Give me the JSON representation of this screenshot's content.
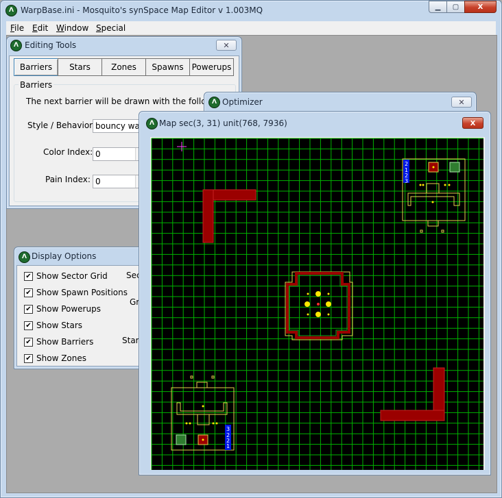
{
  "main_window": {
    "title": "WarpBase.ini - Mosquito's synSpace Map Editor v 1.003MQ",
    "icon": "mosquito-app-icon",
    "minimize_glyph": "▁",
    "maximize_glyph": "▢",
    "close_glyph": "X"
  },
  "menu": {
    "file": {
      "hotkey": "F",
      "rest": "ile"
    },
    "edit": {
      "hotkey": "E",
      "rest": "dit"
    },
    "window": {
      "hotkey": "W",
      "rest": "indow"
    },
    "special": {
      "hotkey": "S",
      "rest": "pecial"
    }
  },
  "editing_tools": {
    "title": "Editing Tools",
    "close_glyph": "✕",
    "tabs": [
      "Barriers",
      "Stars",
      "Zones",
      "Spawns",
      "Powerups"
    ],
    "active_tab": "Barriers",
    "group_label": "Barriers",
    "instruction": "The next barrier will be drawn with the following properti",
    "style_label": "Style / Behavior:",
    "style_value": "bouncy wall",
    "color_label": "Color Index:",
    "color_value": "0",
    "pain_label": "Pain Index:",
    "pain_value": "0"
  },
  "display_options": {
    "title": "Display Options",
    "items": [
      {
        "label": "Show Sector Grid",
        "checked": true
      },
      {
        "label": "Show Spawn Positions",
        "checked": true
      },
      {
        "label": "Show Powerups",
        "checked": true
      },
      {
        "label": "Show Stars",
        "checked": true
      },
      {
        "label": "Show Barriers",
        "checked": true
      },
      {
        "label": "Show Zones",
        "checked": true
      }
    ],
    "right_labels": [
      "Sec",
      "Gri",
      "Star S"
    ],
    "check_glyph": "✔"
  },
  "optimizer": {
    "title": "Optimizer",
    "close_glyph": "✕"
  },
  "map_window": {
    "title": "Map sec(3, 31) unit(768, 7936)",
    "close_glyph": "X",
    "sector": "(3, 31)",
    "unit": "(768, 7936)",
    "colors": {
      "background": "#000000",
      "grid": "#00b400",
      "barrier_fill": "#9b0000",
      "zone": "#e6d24c",
      "spawn_marker": "#ffe600",
      "cursor": "#ff40ff",
      "label_box": "#0018e8"
    },
    "top_right_labels": [
      "2",
      "1",
      "2",
      "3"
    ],
    "bottom_left_labels": [
      "3",
      "2",
      "2",
      "1"
    ]
  }
}
